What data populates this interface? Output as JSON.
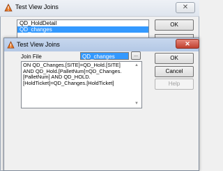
{
  "back_window": {
    "title": "Test View Joins",
    "close_glyph": "✕",
    "list_items": [
      "QD_HoldDetail",
      "QD_changes"
    ],
    "selected_index": 1,
    "ok_label": "OK"
  },
  "front_window": {
    "title": "Test View Joins",
    "close_glyph": "✕",
    "join_file_label": "Join File",
    "join_file_value": "QD_changes",
    "browse_label": "...",
    "join_condition": "ON QD_Changes.[SITE]=QD_Hold.[SITE] AND QD_Hold.[PalletNum]=QD_Changes.[PalletNum] AND QD_HOLD.[HoldTicket]=QD_Changes.[HoldTicket]",
    "buttons": {
      "ok": "OK",
      "cancel": "Cancel",
      "help": "Help"
    }
  },
  "icons": {
    "app": "warning-triangle-icon"
  },
  "colors": {
    "selection": "#3399ff",
    "title_active": "#b4c8e5",
    "close_red": "#c0402f",
    "app_icon": "#e87722"
  }
}
